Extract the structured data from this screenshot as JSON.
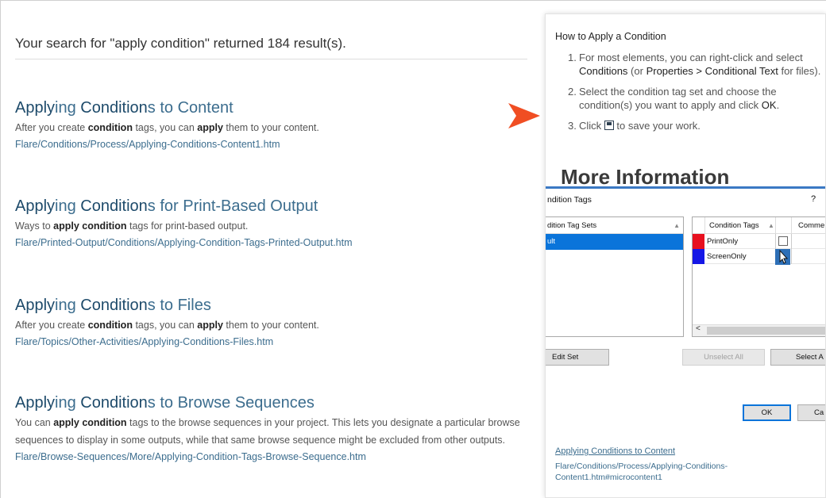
{
  "search": {
    "summary": "Your search for \"apply condition\" returned 184 result(s)."
  },
  "results": [
    {
      "title_parts": [
        {
          "text": "Apply",
          "hl": true
        },
        {
          "text": "ing ",
          "hl": false
        },
        {
          "text": "Condition",
          "hl": true
        },
        {
          "text": "s to Content",
          "hl": false
        }
      ],
      "desc_parts": [
        {
          "text": "After you create ",
          "b": false
        },
        {
          "text": "condition",
          "b": true
        },
        {
          "text": " tags, you can ",
          "b": false
        },
        {
          "text": "apply",
          "b": true
        },
        {
          "text": " them to your content.",
          "b": false
        }
      ],
      "url": "Flare/Conditions/Process/Applying-Conditions-Content1.htm"
    },
    {
      "title_parts": [
        {
          "text": "Apply",
          "hl": true
        },
        {
          "text": "ing ",
          "hl": false
        },
        {
          "text": "Condition",
          "hl": true
        },
        {
          "text": "s for Print-Based Output",
          "hl": false
        }
      ],
      "desc_parts": [
        {
          "text": "Ways to ",
          "b": false
        },
        {
          "text": "apply condition",
          "b": true
        },
        {
          "text": " tags for print-based output.",
          "b": false
        }
      ],
      "url": "Flare/Printed-Output/Conditions/Applying-Condition-Tags-Printed-Output.htm"
    },
    {
      "title_parts": [
        {
          "text": "Apply",
          "hl": true
        },
        {
          "text": "ing ",
          "hl": false
        },
        {
          "text": "Condition",
          "hl": true
        },
        {
          "text": "s to Files",
          "hl": false
        }
      ],
      "desc_parts": [
        {
          "text": "After you create ",
          "b": false
        },
        {
          "text": "condition",
          "b": true
        },
        {
          "text": " tags, you can ",
          "b": false
        },
        {
          "text": "apply",
          "b": true
        },
        {
          "text": " them to your content.",
          "b": false
        }
      ],
      "url": "Flare/Topics/Other-Activities/Applying-Conditions-Files.htm"
    },
    {
      "title_parts": [
        {
          "text": "Apply",
          "hl": true
        },
        {
          "text": "ing ",
          "hl": false
        },
        {
          "text": "Condition",
          "hl": true
        },
        {
          "text": "s to Browse Sequences",
          "hl": false
        }
      ],
      "desc_parts": [
        {
          "text": "You can ",
          "b": false
        },
        {
          "text": "apply condition",
          "b": true
        },
        {
          "text": " tags to the browse sequences in your project. This lets you designate a particular browse sequences to display in some outputs, while that same browse sequence might be excluded from other outputs.",
          "b": false
        }
      ],
      "url": "Flare/Browse-Sequences/More/Applying-Condition-Tags-Browse-Sequence.htm"
    }
  ],
  "popup": {
    "title": "How to Apply a Condition",
    "steps": [
      {
        "num": "1.",
        "parts": [
          {
            "text": "For most elements, you can right-click and select ",
            "b": false
          },
          {
            "text": "Conditions",
            "b": true
          },
          {
            "text": " (or ",
            "b": false
          },
          {
            "text": "Properties > Conditional Text",
            "b": true
          },
          {
            "text": " for files).",
            "b": false
          }
        ]
      },
      {
        "num": "2.",
        "parts": [
          {
            "text": "Select the condition tag set and choose the condition(s) you want to apply and click ",
            "b": false
          },
          {
            "text": "OK",
            "b": true
          },
          {
            "text": ".",
            "b": false
          }
        ]
      },
      {
        "num": "3.",
        "parts": [
          {
            "text": "Click ",
            "b": false
          },
          {
            "icon": "save-icon"
          },
          {
            "text": " to save your work.",
            "b": false
          }
        ]
      }
    ],
    "more_info": "More Information",
    "dialog": {
      "title": "ndition Tags",
      "help": "?",
      "sets_header": "dition Tag Sets",
      "sets_selected": "ult",
      "tags_header": "Condition Tags",
      "comments_header": "Comme",
      "tags": [
        {
          "name": "PrintOnly",
          "color": "#e8101e"
        },
        {
          "name": "ScreenOnly",
          "color": "#1517e6"
        }
      ],
      "buttons": {
        "edit_set": "Edit Set",
        "unselect_all": "Unselect All",
        "select_all": "Select A",
        "ok": "OK",
        "cancel": "Ca"
      }
    },
    "link_title": "Applying Conditions to Content",
    "link_url": "Flare/Conditions/Process/Applying-Conditions-Content1.htm#microcontent1"
  },
  "colors": {
    "accent_arrow": "#f04e23",
    "link": "#3c6d8e",
    "dialog_border": "#3b79c4",
    "selection": "#0a74da"
  }
}
